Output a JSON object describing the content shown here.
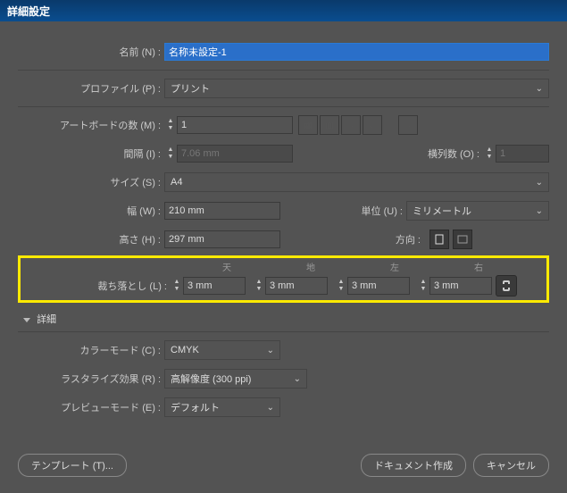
{
  "title": "詳細設定",
  "labels": {
    "name": "名前 (N) :",
    "profile": "プロファイル (P) :",
    "artboards": "アートボードの数 (M) :",
    "spacing": "間隔 (I) :",
    "columns": "横列数 (O) :",
    "size": "サイズ (S) :",
    "width": "幅 (W) :",
    "unit": "単位 (U) :",
    "height": "高さ (H) :",
    "orientation": "方向 :",
    "bleed": "裁ち落とし (L) :",
    "detail": "詳細",
    "colormode": "カラーモード (C) :",
    "raster": "ラスタライズ効果 (R) :",
    "preview": "プレビューモード (E) :"
  },
  "bleed_headers": {
    "top": "天",
    "bottom": "地",
    "left": "左",
    "right": "右"
  },
  "values": {
    "name": "名称未設定-1",
    "profile": "プリント",
    "artboards": "1",
    "spacing": "7.06 mm",
    "columns": "1",
    "size": "A4",
    "width": "210 mm",
    "unit": "ミリメートル",
    "height": "297 mm",
    "bleed_top": "3 mm",
    "bleed_bottom": "3 mm",
    "bleed_left": "3 mm",
    "bleed_right": "3 mm",
    "colormode": "CMYK",
    "raster": "高解像度 (300 ppi)",
    "preview": "デフォルト"
  },
  "buttons": {
    "template": "テンプレート (T)...",
    "create": "ドキュメント作成",
    "cancel": "キャンセル"
  }
}
